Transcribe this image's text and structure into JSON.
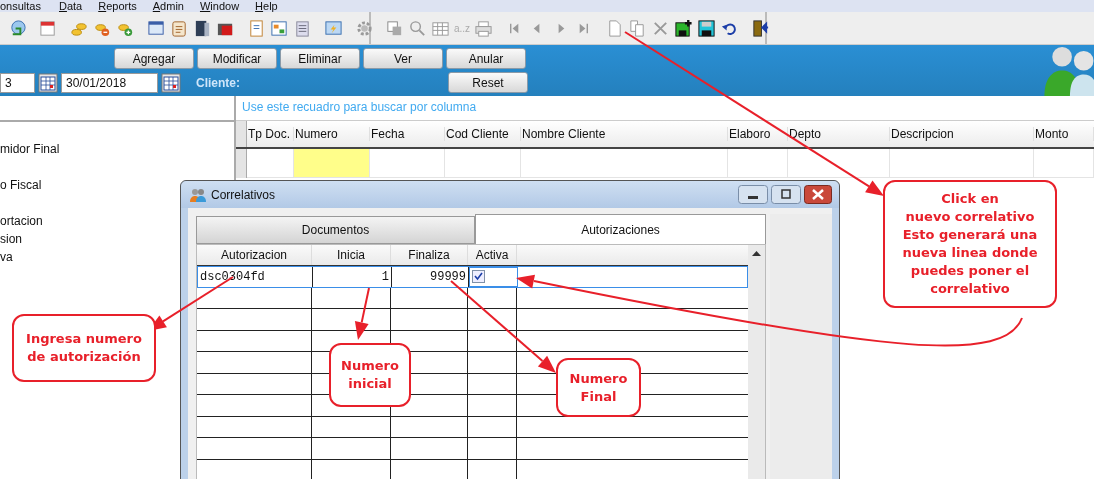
{
  "menu": [
    {
      "label": "onsultas",
      "mnemonic": false
    },
    {
      "label": "Data",
      "mnemonic": true
    },
    {
      "label": "Reports",
      "mnemonic": true
    },
    {
      "label": "Admin",
      "mnemonic": true
    },
    {
      "label": "Window",
      "mnemonic": true
    },
    {
      "label": "Help",
      "mnemonic": true
    }
  ],
  "toolbar": {
    "sort_label": "a..z"
  },
  "actions": {
    "buttons": [
      "Agregar",
      "Modificar",
      "Eliminar",
      "Ver",
      "Anular"
    ],
    "reset": "Reset",
    "date_from": "3",
    "date_to": "30/01/2018",
    "client_label": "Cliente:"
  },
  "left_list": [
    "midor Final",
    "o Fiscal",
    "ortacion",
    "sion",
    "va"
  ],
  "search_hint": "Use este recuadro para buscar por columna",
  "main_grid": {
    "columns": [
      {
        "label": "Tp Doc.",
        "current": false
      },
      {
        "label": "Numero",
        "current": true
      },
      {
        "label": "Fecha",
        "current": false
      },
      {
        "label": "Cod Cliente",
        "current": false
      },
      {
        "label": "Nombre Cliente",
        "current": false
      },
      {
        "label": "Elaboro",
        "current": false
      },
      {
        "label": "Depto",
        "current": false
      },
      {
        "label": "Descripcion",
        "current": false
      },
      {
        "label": "Monto",
        "current": false
      }
    ]
  },
  "dialog": {
    "title": "Correlativos",
    "tabs": [
      {
        "label": "Documentos",
        "selected": false
      },
      {
        "label": "Autorizaciones",
        "selected": true
      }
    ],
    "columns": [
      "Autorizacion",
      "Inicia",
      "Finaliza",
      "Activa"
    ],
    "rows": [
      {
        "autorizacion": "dsc0304fd",
        "inicia": "1",
        "finaliza": "99999",
        "activa": true,
        "selected": true
      }
    ]
  },
  "callouts": [
    {
      "text": "Click en\nnuevo correlativo\nEsto generará una\nnueva linea donde\npuedes poner el\ncorrelativo"
    },
    {
      "text": "Ingresa numero\nde autorización"
    },
    {
      "text": "Numero\ninicial"
    },
    {
      "text": "Numero\nFinal"
    }
  ]
}
